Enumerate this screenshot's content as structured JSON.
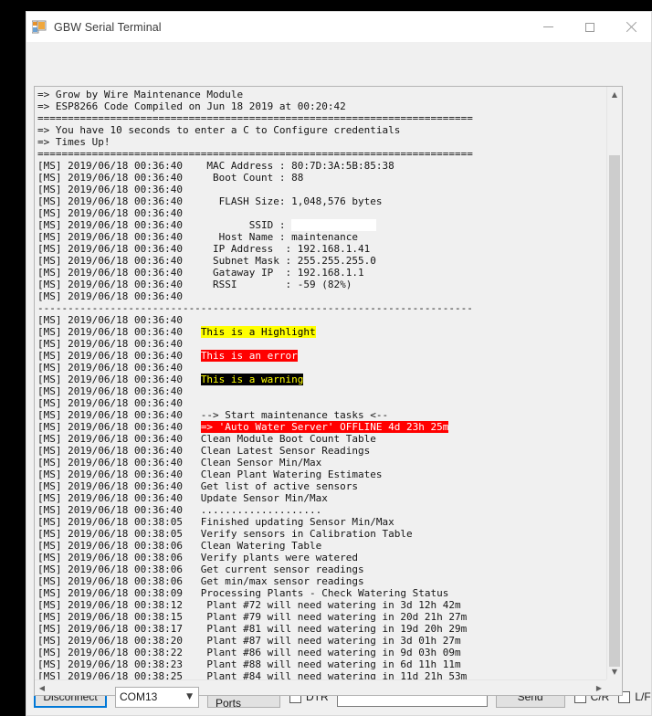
{
  "window": {
    "title": "GBW Serial Terminal",
    "icon": "form-designer-icon",
    "controls": {
      "minimize": "minimize-icon",
      "maximize": "maximize-icon",
      "close": "close-icon"
    }
  },
  "terminal": {
    "lines": [
      {
        "text": "=> Grow by Wire Maintenance Module"
      },
      {
        "text": "=> ESP8266 Code Compiled on Jun 18 2019 at 00:20:42"
      },
      {
        "text": "========================================================================"
      },
      {
        "text": "=> You have 10 seconds to enter a C to Configure credentials"
      },
      {
        "text": "=> Times Up!"
      },
      {
        "text": "========================================================================"
      },
      {
        "text": "[MS] 2019/06/18 00:36:40    MAC Address : 80:7D:3A:5B:85:38"
      },
      {
        "text": "[MS] 2019/06/18 00:36:40     Boot Count : 88"
      },
      {
        "text": "[MS] 2019/06/18 00:36:40"
      },
      {
        "text": "[MS] 2019/06/18 00:36:40      FLASH Size: 1,048,576 bytes"
      },
      {
        "text": "[MS] 2019/06/18 00:36:40"
      },
      {
        "prefix": "[MS] 2019/06/18 00:36:40           SSID : ",
        "redacted": "xxxxxxxxxxxxxx"
      },
      {
        "text": "[MS] 2019/06/18 00:36:40      Host Name : maintenance"
      },
      {
        "text": "[MS] 2019/06/18 00:36:40     IP Address  : 192.168.1.41"
      },
      {
        "text": "[MS] 2019/06/18 00:36:40     Subnet Mask : 255.255.255.0"
      },
      {
        "text": "[MS] 2019/06/18 00:36:40     Gataway IP  : 192.168.1.1"
      },
      {
        "text": "[MS] 2019/06/18 00:36:40     RSSI        : -59 (82%)"
      },
      {
        "text": "[MS] 2019/06/18 00:36:40"
      },
      {
        "text": "------------------------------------------------------------------------"
      },
      {
        "text": "[MS] 2019/06/18 00:36:40"
      },
      {
        "prefix": "[MS] 2019/06/18 00:36:40   ",
        "mark": "This is a Highlight",
        "style": "hl-yellow"
      },
      {
        "text": "[MS] 2019/06/18 00:36:40"
      },
      {
        "prefix": "[MS] 2019/06/18 00:36:40   ",
        "mark": "This is an error",
        "style": "hl-error"
      },
      {
        "text": "[MS] 2019/06/18 00:36:40"
      },
      {
        "prefix": "[MS] 2019/06/18 00:36:40   ",
        "mark": "This is a warning",
        "style": "hl-warn"
      },
      {
        "text": "[MS] 2019/06/18 00:36:40"
      },
      {
        "text": "[MS] 2019/06/18 00:36:40"
      },
      {
        "text": "[MS] 2019/06/18 00:36:40   --> Start maintenance tasks <--"
      },
      {
        "prefix": "[MS] 2019/06/18 00:36:40   ",
        "mark": "=> 'Auto Water Server' OFFLINE 4d 23h 25m",
        "style": "hl-error"
      },
      {
        "text": "[MS] 2019/06/18 00:36:40   Clean Module Boot Count Table"
      },
      {
        "text": "[MS] 2019/06/18 00:36:40   Clean Latest Sensor Readings"
      },
      {
        "text": "[MS] 2019/06/18 00:36:40   Clean Sensor Min/Max"
      },
      {
        "text": "[MS] 2019/06/18 00:36:40   Clean Plant Watering Estimates"
      },
      {
        "text": "[MS] 2019/06/18 00:36:40   Get list of active sensors"
      },
      {
        "text": "[MS] 2019/06/18 00:36:40   Update Sensor Min/Max"
      },
      {
        "text": "[MS] 2019/06/18 00:36:40   ...................."
      },
      {
        "text": "[MS] 2019/06/18 00:38:05   Finished updating Sensor Min/Max"
      },
      {
        "text": "[MS] 2019/06/18 00:38:05   Verify sensors in Calibration Table"
      },
      {
        "text": "[MS] 2019/06/18 00:38:06   Clean Watering Table"
      },
      {
        "text": "[MS] 2019/06/18 00:38:06   Verify plants were watered"
      },
      {
        "text": "[MS] 2019/06/18 00:38:06   Get current sensor readings"
      },
      {
        "text": "[MS] 2019/06/18 00:38:06   Get min/max sensor readings"
      },
      {
        "text": "[MS] 2019/06/18 00:38:09   Processing Plants - Check Watering Status"
      },
      {
        "text": "[MS] 2019/06/18 00:38:12    Plant #72 will need watering in 3d 12h 42m"
      },
      {
        "text": "[MS] 2019/06/18 00:38:15    Plant #79 will need watering in 20d 21h 27m"
      },
      {
        "text": "[MS] 2019/06/18 00:38:17    Plant #81 will need watering in 19d 20h 29m"
      },
      {
        "text": "[MS] 2019/06/18 00:38:20    Plant #87 will need watering in 3d 01h 27m"
      },
      {
        "text": "[MS] 2019/06/18 00:38:22    Plant #86 will need watering in 9d 03h 09m"
      },
      {
        "text": "[MS] 2019/06/18 00:38:23    Plant #88 will need watering in 6d 11h 11m"
      },
      {
        "text": "[MS] 2019/06/18 00:38:25    Plant #84 will need watering in 11d 21h 53m"
      }
    ],
    "scroll": {
      "up_arrow": "chevron-up-icon",
      "down_arrow": "chevron-down-icon",
      "left_arrow": "chevron-left-icon",
      "right_arrow": "chevron-right-icon"
    }
  },
  "toolbar": {
    "disconnect_label": "Disconnect",
    "port_value": "COM13",
    "port_caret": "chevron-down-icon",
    "refresh_label": "Refresh Ports",
    "dtr_label": "DTR",
    "send_value": "",
    "send_placeholder": "",
    "send_label": "Send",
    "cr_label": "C/R",
    "lf_label": "L/F"
  },
  "colors": {
    "accent": "#0078d7",
    "highlight": "#ffff00",
    "error": "#ff0000",
    "warning_bg": "#000000",
    "warning_fg": "#ffff00",
    "window_bg": "#f0f0f0"
  }
}
